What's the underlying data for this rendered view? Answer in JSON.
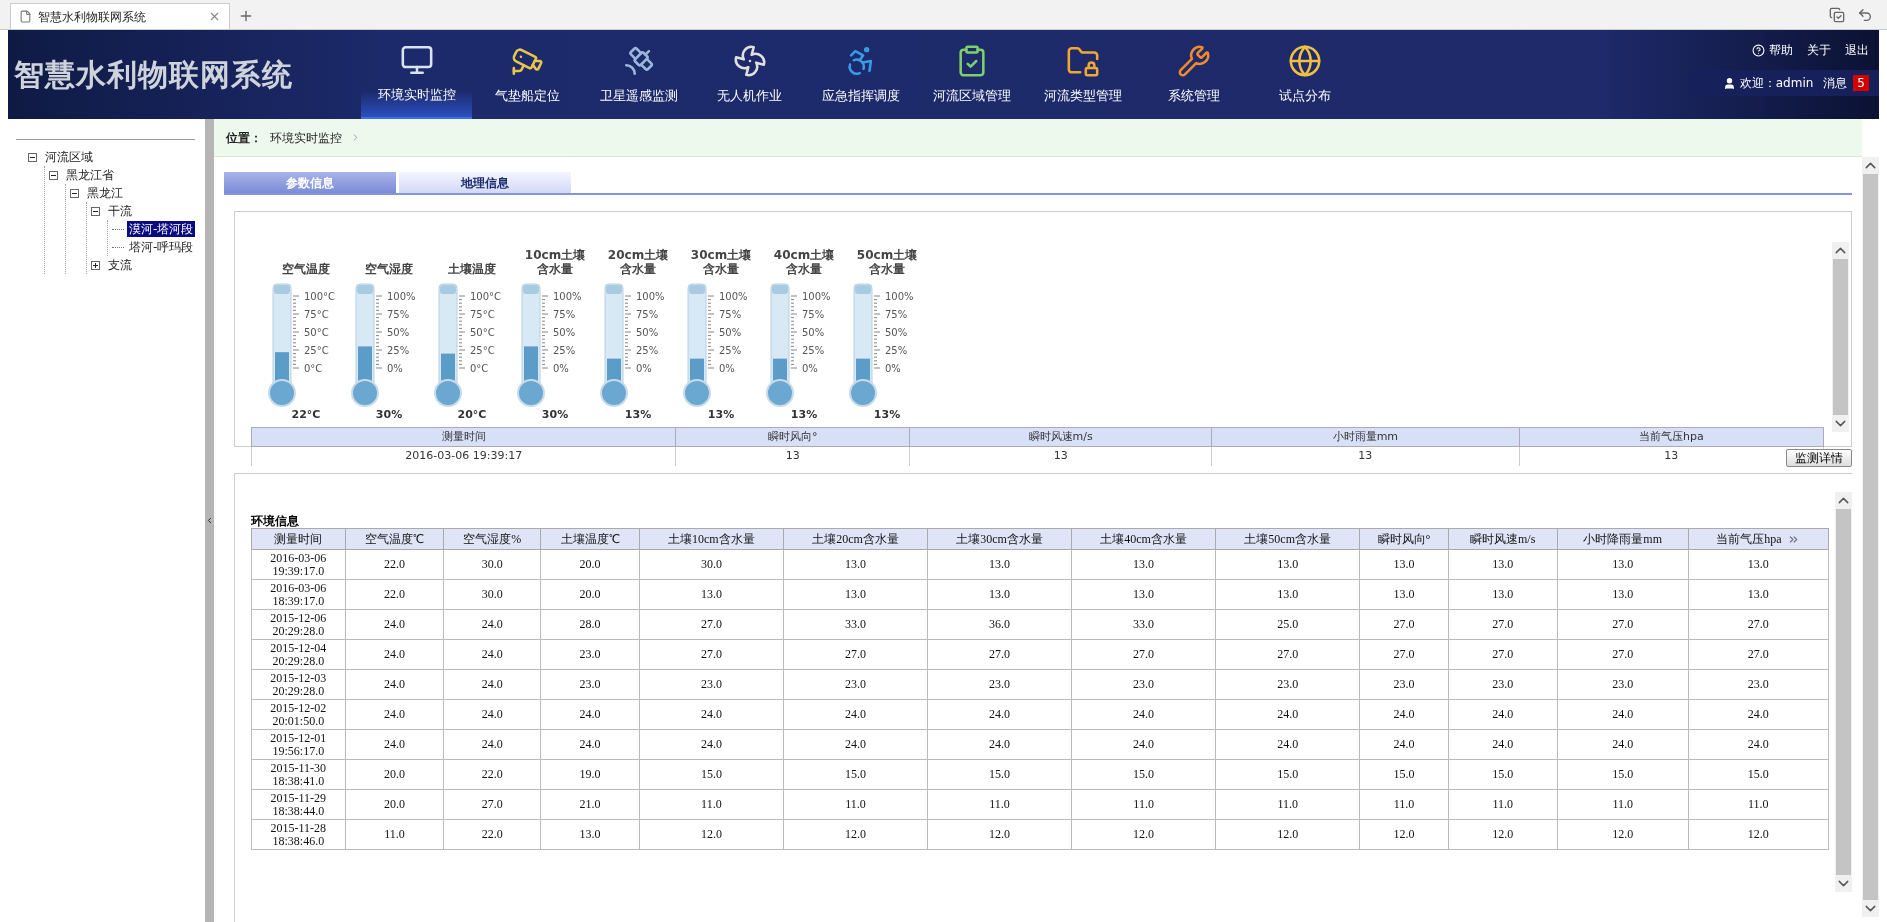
{
  "browser_tab": {
    "title": "智慧水利物联网系统"
  },
  "header": {
    "logo": "智慧水利物联网系统",
    "nav": [
      {
        "label": "环境实时监控",
        "selected": true
      },
      {
        "label": "气垫船定位",
        "selected": false
      },
      {
        "label": "卫星遥感监测",
        "selected": false
      },
      {
        "label": "无人机作业",
        "selected": false
      },
      {
        "label": "应急指挥调度",
        "selected": false
      },
      {
        "label": "河流区域管理",
        "selected": false
      },
      {
        "label": "河流类型管理",
        "selected": false
      },
      {
        "label": "系统管理",
        "selected": false
      },
      {
        "label": "试点分布",
        "selected": false
      }
    ],
    "links": [
      "帮助",
      "关于",
      "退出"
    ],
    "welcome": "欢迎：admin",
    "messages": "消息",
    "message_count": "5"
  },
  "tree": [
    {
      "label": "河流区域",
      "expanded": true,
      "selected": false,
      "children": [
        {
          "label": "黑龙江省",
          "expanded": true,
          "selected": false,
          "children": [
            {
              "label": "黑龙江",
              "expanded": true,
              "selected": false,
              "children": [
                {
                  "label": "干流",
                  "expanded": true,
                  "selected": false,
                  "children": [
                    {
                      "label": "漠河-塔河段",
                      "selected": true
                    },
                    {
                      "label": "塔河-呼玛段",
                      "selected": false
                    }
                  ]
                },
                {
                  "label": "支流",
                  "expanded": false,
                  "selected": false
                }
              ]
            }
          ]
        }
      ]
    }
  ],
  "breadcrumb": {
    "label": "位置：",
    "path": "环境实时监控"
  },
  "tabs": [
    {
      "label": "参数信息",
      "selected": true
    },
    {
      "label": "地理信息",
      "selected": false
    }
  ],
  "gauges": [
    {
      "label": [
        "空气温度"
      ],
      "level": 0.22,
      "reading": "22°C",
      "ticks": [
        "100°C",
        "75°C",
        "50°C",
        "25°C",
        "0°C"
      ]
    },
    {
      "label": [
        "空气湿度"
      ],
      "level": 0.3,
      "reading": "30%",
      "ticks": [
        "100%",
        "75%",
        "50%",
        "25%",
        "0%"
      ]
    },
    {
      "label": [
        "土壤温度"
      ],
      "level": 0.2,
      "reading": "20°C",
      "ticks": [
        "100°C",
        "75°C",
        "50°C",
        "25°C",
        "0°C"
      ]
    },
    {
      "label": [
        "10cm土壤",
        "含水量"
      ],
      "level": 0.3,
      "reading": "30%",
      "ticks": [
        "100%",
        "75%",
        "50%",
        "25%",
        "0%"
      ]
    },
    {
      "label": [
        "20cm土壤",
        "含水量"
      ],
      "level": 0.13,
      "reading": "13%",
      "ticks": [
        "100%",
        "75%",
        "50%",
        "25%",
        "0%"
      ]
    },
    {
      "label": [
        "30cm土壤",
        "含水量"
      ],
      "level": 0.13,
      "reading": "13%",
      "ticks": [
        "100%",
        "75%",
        "50%",
        "25%",
        "0%"
      ]
    },
    {
      "label": [
        "40cm土壤",
        "含水量"
      ],
      "level": 0.13,
      "reading": "13%",
      "ticks": [
        "100%",
        "75%",
        "50%",
        "25%",
        "0%"
      ]
    },
    {
      "label": [
        "50cm土壤",
        "含水量"
      ],
      "level": 0.13,
      "reading": "13%",
      "ticks": [
        "100%",
        "75%",
        "50%",
        "25%",
        "0%"
      ]
    }
  ],
  "summary": {
    "columns": [
      "测量时间",
      "瞬时风向°",
      "瞬时风速m/s",
      "小时雨量mm",
      "当前气压hpa"
    ],
    "row": [
      "2016-03-06 19:39:17",
      "13",
      "13",
      "13",
      "13"
    ]
  },
  "detail_button": "监测详情",
  "env_table": {
    "title": "环境信息",
    "columns": [
      "测量时间",
      "空气温度℃",
      "空气湿度%",
      "土壤温度℃",
      "土壤10cm含水量",
      "土壤20cm含水量",
      "土壤30cm含水量",
      "土壤40cm含水量",
      "土壤50cm含水量",
      "瞬时风向°",
      "瞬时风速m/s",
      "小时降雨量mm",
      "当前气压hpa"
    ],
    "rows": [
      [
        "2016-03-06\n19:39:17.0",
        "22.0",
        "30.0",
        "20.0",
        "30.0",
        "13.0",
        "13.0",
        "13.0",
        "13.0",
        "13.0",
        "13.0",
        "13.0",
        "13.0"
      ],
      [
        "2016-03-06\n18:39:17.0",
        "22.0",
        "30.0",
        "20.0",
        "13.0",
        "13.0",
        "13.0",
        "13.0",
        "13.0",
        "13.0",
        "13.0",
        "13.0",
        "13.0"
      ],
      [
        "2015-12-06\n20:29:28.0",
        "24.0",
        "24.0",
        "28.0",
        "27.0",
        "33.0",
        "36.0",
        "33.0",
        "25.0",
        "27.0",
        "27.0",
        "27.0",
        "27.0"
      ],
      [
        "2015-12-04\n20:29:28.0",
        "24.0",
        "24.0",
        "23.0",
        "27.0",
        "27.0",
        "27.0",
        "27.0",
        "27.0",
        "27.0",
        "27.0",
        "27.0",
        "27.0"
      ],
      [
        "2015-12-03\n20:29:28.0",
        "24.0",
        "24.0",
        "23.0",
        "23.0",
        "23.0",
        "23.0",
        "23.0",
        "23.0",
        "23.0",
        "23.0",
        "23.0",
        "23.0"
      ],
      [
        "2015-12-02\n20:01:50.0",
        "24.0",
        "24.0",
        "24.0",
        "24.0",
        "24.0",
        "24.0",
        "24.0",
        "24.0",
        "24.0",
        "24.0",
        "24.0",
        "24.0"
      ],
      [
        "2015-12-01\n19:56:17.0",
        "24.0",
        "24.0",
        "24.0",
        "24.0",
        "24.0",
        "24.0",
        "24.0",
        "24.0",
        "24.0",
        "24.0",
        "24.0",
        "24.0"
      ],
      [
        "2015-11-30\n18:38:41.0",
        "20.0",
        "22.0",
        "19.0",
        "15.0",
        "15.0",
        "15.0",
        "15.0",
        "15.0",
        "15.0",
        "15.0",
        "15.0",
        "15.0"
      ],
      [
        "2015-11-29\n18:38:44.0",
        "20.0",
        "27.0",
        "21.0",
        "11.0",
        "11.0",
        "11.0",
        "11.0",
        "11.0",
        "11.0",
        "11.0",
        "11.0",
        "11.0"
      ],
      [
        "2015-11-28\n18:38:46.0",
        "11.0",
        "22.0",
        "13.0",
        "12.0",
        "12.0",
        "12.0",
        "12.0",
        "12.0",
        "12.0",
        "12.0",
        "12.0",
        "12.0"
      ]
    ]
  }
}
